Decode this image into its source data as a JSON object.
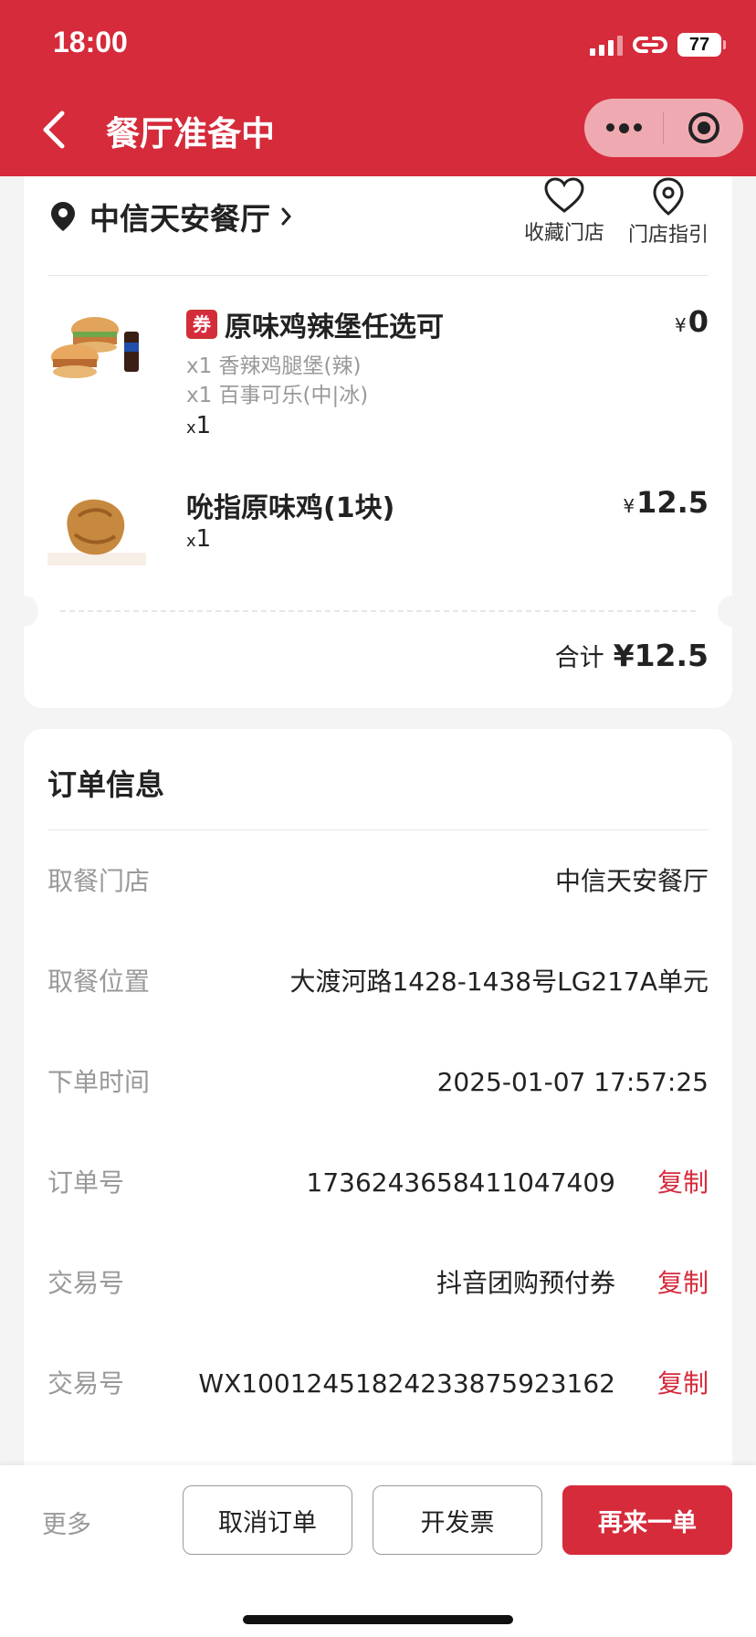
{
  "status_bar": {
    "time": "18:00",
    "battery": "77"
  },
  "nav": {
    "title": "餐厅准备中"
  },
  "store": {
    "name": "中信天安餐厅",
    "favorite_label": "收藏门店",
    "guide_label": "门店指引"
  },
  "items": [
    {
      "coupon_tag": "券",
      "name": "原味鸡辣堡任选可",
      "subs": [
        "x1 香辣鸡腿堡(辣)",
        "x1 百事可乐(中|冰)"
      ],
      "qty_x": "x",
      "qty": "1",
      "currency": "¥",
      "price": "0"
    },
    {
      "name": "吮指原味鸡(1块)",
      "qty_x": "x",
      "qty": "1",
      "currency": "¥",
      "price": "12.5"
    }
  ],
  "total": {
    "label": "合计",
    "value": "¥12.5"
  },
  "order_info": {
    "title": "订单信息",
    "rows": [
      {
        "label": "取餐门店",
        "value": "中信天安餐厅"
      },
      {
        "label": "取餐位置",
        "value": "大渡河路1428-1438号LG217A单元"
      },
      {
        "label": "下单时间",
        "value": "2025-01-07 17:57:25"
      },
      {
        "label": "订单号",
        "value": "1736243658411047409",
        "copy": "复制"
      },
      {
        "label": "交易号",
        "value": "抖音团购预付券",
        "copy": "复制"
      },
      {
        "label": "交易号",
        "value": "WX1001245182423387592316​2",
        "copy": "复制"
      }
    ]
  },
  "bottom_bar": {
    "more": "更多",
    "cancel": "取消订单",
    "invoice": "开发票",
    "reorder": "再来一单"
  },
  "colors": {
    "brand_red": "#d52b3b"
  }
}
